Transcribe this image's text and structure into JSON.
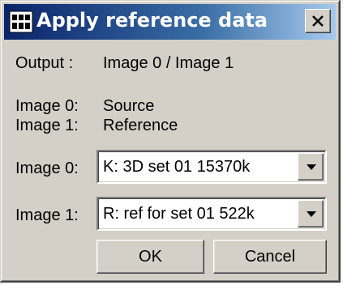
{
  "window": {
    "title": "Apply reference data",
    "icons": {
      "app": "reference-app-icon",
      "close": "close-icon"
    }
  },
  "info": {
    "output_label": "Output :",
    "output_value": "Image 0 / Image 1",
    "image0_label": "Image 0:",
    "image0_value": "Source",
    "image1_label": "Image 1:",
    "image1_value": "Reference"
  },
  "selectors": {
    "image0": {
      "label": "Image 0:",
      "selected": "K: 3D set 01  15370k"
    },
    "image1": {
      "label": "Image 1:",
      "selected": "R: ref for set 01  522k"
    }
  },
  "buttons": {
    "ok": "OK",
    "cancel": "Cancel"
  },
  "colors": {
    "dialog_face": "#d4d0c8",
    "titlebar_start": "#0a246a",
    "titlebar_end": "#a6caf0"
  }
}
